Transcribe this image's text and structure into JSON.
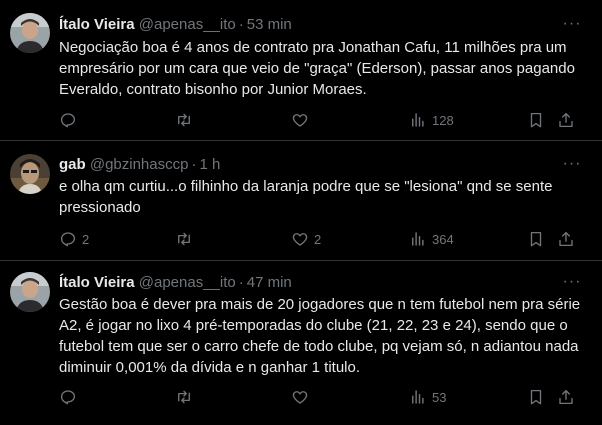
{
  "colors": {
    "background": "#000000",
    "text": "#e7e9ea",
    "muted": "#71767b",
    "divider": "#2f3336"
  },
  "icons": {
    "reply": "reply-icon",
    "retweet": "retweet-icon",
    "like": "heart-icon",
    "views": "views-chart-icon",
    "bookmark": "bookmark-icon",
    "share": "share-icon",
    "more": "more-dots-icon"
  },
  "tweets": [
    {
      "name": "Ítalo Vieira",
      "handle": "@apenas__ito",
      "separator": "·",
      "time": "53 min",
      "text": "Negociação boa é 4 anos de contrato pra Jonathan Cafu, 11 milhões pra um empresário por um cara que veio de \"graça\" (Ederson), passar anos pagando Everaldo, contrato bisonho por Junior Moraes.",
      "replies": "",
      "retweets": "",
      "likes": "",
      "views": "128"
    },
    {
      "name": "gab",
      "handle": "@gbzinhasccp",
      "separator": "·",
      "time": "1 h",
      "text": "e olha qm curtiu...o filhinho da laranja podre que se \"lesiona\" qnd se sente pressionado",
      "replies": "2",
      "retweets": "",
      "likes": "2",
      "views": "364"
    },
    {
      "name": "Ítalo Vieira",
      "handle": "@apenas__ito",
      "separator": "·",
      "time": "47 min",
      "text": "Gestão boa é dever pra mais de 20 jogadores que n tem futebol nem pra série A2, é jogar no lixo 4 pré-temporadas do clube (21, 22, 23 e 24), sendo que o futebol tem que ser o carro chefe de todo clube, pq vejam só, n adiantou nada diminuir 0,001% da dívida e n ganhar 1 titulo.",
      "replies": "",
      "retweets": "",
      "likes": "",
      "views": "53"
    }
  ]
}
